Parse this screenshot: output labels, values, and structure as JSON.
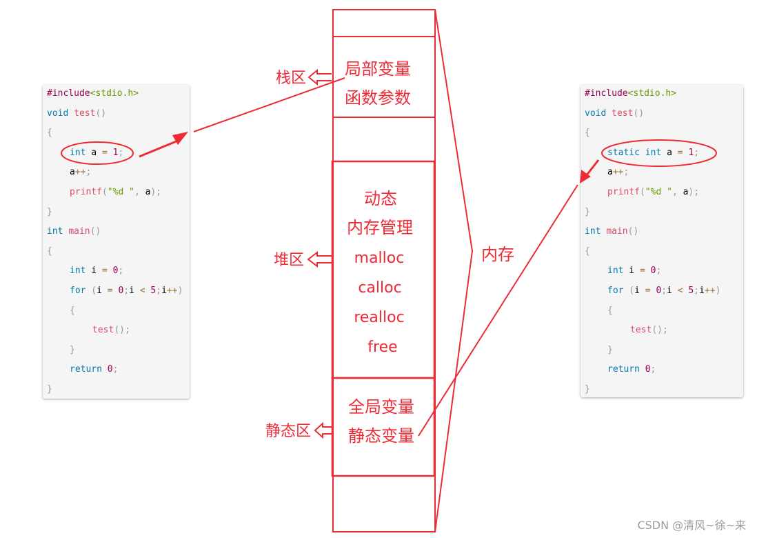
{
  "colors": {
    "accent": "#ee2a35",
    "code_bg": "#f5f5f5",
    "keyword": "#0077aa",
    "function": "#dd4a68",
    "string": "#669900",
    "number": "#990055"
  },
  "left_code": {
    "lines": [
      {
        "indent": 0,
        "tokens": [
          {
            "t": "#include",
            "c": "inc"
          },
          {
            "t": "<stdio.h>",
            "c": "hdr"
          }
        ]
      },
      {
        "indent": 0,
        "tokens": [
          {
            "t": "void",
            "c": "k"
          },
          {
            "t": " ",
            "c": "v"
          },
          {
            "t": "test",
            "c": "fn"
          },
          {
            "t": "()",
            "c": "p"
          }
        ]
      },
      {
        "indent": 0,
        "tokens": [
          {
            "t": "{",
            "c": "p"
          }
        ]
      },
      {
        "indent": 1,
        "tokens": [
          {
            "t": "int",
            "c": "k"
          },
          {
            "t": " a ",
            "c": "v"
          },
          {
            "t": "=",
            "c": "op"
          },
          {
            "t": " ",
            "c": "v"
          },
          {
            "t": "1",
            "c": "num"
          },
          {
            "t": ";",
            "c": "p"
          }
        ]
      },
      {
        "indent": 1,
        "tokens": [
          {
            "t": "a",
            "c": "v"
          },
          {
            "t": "++",
            "c": "op"
          },
          {
            "t": ";",
            "c": "p"
          }
        ]
      },
      {
        "indent": 1,
        "tokens": [
          {
            "t": "printf",
            "c": "fn"
          },
          {
            "t": "(",
            "c": "p"
          },
          {
            "t": "\"%d \"",
            "c": "str"
          },
          {
            "t": ", ",
            "c": "p"
          },
          {
            "t": "a",
            "c": "v"
          },
          {
            "t": ");",
            "c": "p"
          }
        ]
      },
      {
        "indent": 0,
        "tokens": [
          {
            "t": "}",
            "c": "p"
          }
        ]
      },
      {
        "indent": 0,
        "tokens": [
          {
            "t": "int",
            "c": "k"
          },
          {
            "t": " ",
            "c": "v"
          },
          {
            "t": "main",
            "c": "fn"
          },
          {
            "t": "()",
            "c": "p"
          }
        ]
      },
      {
        "indent": 0,
        "tokens": [
          {
            "t": "{",
            "c": "p"
          }
        ]
      },
      {
        "indent": 1,
        "tokens": [
          {
            "t": "int",
            "c": "k"
          },
          {
            "t": " i ",
            "c": "v"
          },
          {
            "t": "=",
            "c": "op"
          },
          {
            "t": " ",
            "c": "v"
          },
          {
            "t": "0",
            "c": "num"
          },
          {
            "t": ";",
            "c": "p"
          }
        ]
      },
      {
        "indent": 1,
        "tokens": [
          {
            "t": "for",
            "c": "k"
          },
          {
            "t": " (",
            "c": "p"
          },
          {
            "t": "i ",
            "c": "v"
          },
          {
            "t": "=",
            "c": "op"
          },
          {
            "t": " ",
            "c": "v"
          },
          {
            "t": "0",
            "c": "num"
          },
          {
            "t": ";",
            "c": "p"
          },
          {
            "t": "i ",
            "c": "v"
          },
          {
            "t": "<",
            "c": "op"
          },
          {
            "t": " ",
            "c": "v"
          },
          {
            "t": "5",
            "c": "num"
          },
          {
            "t": ";",
            "c": "p"
          },
          {
            "t": "i",
            "c": "v"
          },
          {
            "t": "++",
            "c": "op"
          },
          {
            "t": ")",
            "c": "p"
          }
        ]
      },
      {
        "indent": 1,
        "tokens": [
          {
            "t": "{",
            "c": "p"
          }
        ]
      },
      {
        "indent": 2,
        "tokens": [
          {
            "t": "test",
            "c": "fn"
          },
          {
            "t": "();",
            "c": "p"
          }
        ]
      },
      {
        "indent": 1,
        "tokens": [
          {
            "t": "}",
            "c": "p"
          }
        ]
      },
      {
        "indent": 1,
        "tokens": [
          {
            "t": "return",
            "c": "k"
          },
          {
            "t": " ",
            "c": "v"
          },
          {
            "t": "0",
            "c": "num"
          },
          {
            "t": ";",
            "c": "p"
          }
        ]
      },
      {
        "indent": 0,
        "tokens": [
          {
            "t": "}",
            "c": "p"
          }
        ]
      }
    ],
    "highlighted_line": "int a = 1;"
  },
  "right_code": {
    "lines": [
      {
        "indent": 0,
        "tokens": [
          {
            "t": "#include",
            "c": "inc"
          },
          {
            "t": "<stdio.h>",
            "c": "hdr"
          }
        ]
      },
      {
        "indent": 0,
        "tokens": [
          {
            "t": "void",
            "c": "k"
          },
          {
            "t": " ",
            "c": "v"
          },
          {
            "t": "test",
            "c": "fn"
          },
          {
            "t": "()",
            "c": "p"
          }
        ]
      },
      {
        "indent": 0,
        "tokens": [
          {
            "t": "{",
            "c": "p"
          }
        ]
      },
      {
        "indent": 1,
        "tokens": [
          {
            "t": "static",
            "c": "k"
          },
          {
            "t": " ",
            "c": "v"
          },
          {
            "t": "int",
            "c": "k"
          },
          {
            "t": " a ",
            "c": "v"
          },
          {
            "t": "=",
            "c": "op"
          },
          {
            "t": " ",
            "c": "v"
          },
          {
            "t": "1",
            "c": "num"
          },
          {
            "t": ";",
            "c": "p"
          }
        ]
      },
      {
        "indent": 1,
        "tokens": [
          {
            "t": "a",
            "c": "v"
          },
          {
            "t": "++",
            "c": "op"
          },
          {
            "t": ";",
            "c": "p"
          }
        ]
      },
      {
        "indent": 1,
        "tokens": [
          {
            "t": "printf",
            "c": "fn"
          },
          {
            "t": "(",
            "c": "p"
          },
          {
            "t": "\"%d \"",
            "c": "str"
          },
          {
            "t": ", ",
            "c": "p"
          },
          {
            "t": "a",
            "c": "v"
          },
          {
            "t": ");",
            "c": "p"
          }
        ]
      },
      {
        "indent": 0,
        "tokens": [
          {
            "t": "}",
            "c": "p"
          }
        ]
      },
      {
        "indent": 0,
        "tokens": [
          {
            "t": "int",
            "c": "k"
          },
          {
            "t": " ",
            "c": "v"
          },
          {
            "t": "main",
            "c": "fn"
          },
          {
            "t": "()",
            "c": "p"
          }
        ]
      },
      {
        "indent": 0,
        "tokens": [
          {
            "t": "{",
            "c": "p"
          }
        ]
      },
      {
        "indent": 1,
        "tokens": [
          {
            "t": "int",
            "c": "k"
          },
          {
            "t": " i ",
            "c": "v"
          },
          {
            "t": "=",
            "c": "op"
          },
          {
            "t": " ",
            "c": "v"
          },
          {
            "t": "0",
            "c": "num"
          },
          {
            "t": ";",
            "c": "p"
          }
        ]
      },
      {
        "indent": 1,
        "tokens": [
          {
            "t": "for",
            "c": "k"
          },
          {
            "t": " (",
            "c": "p"
          },
          {
            "t": "i ",
            "c": "v"
          },
          {
            "t": "=",
            "c": "op"
          },
          {
            "t": " ",
            "c": "v"
          },
          {
            "t": "0",
            "c": "num"
          },
          {
            "t": ";",
            "c": "p"
          },
          {
            "t": "i ",
            "c": "v"
          },
          {
            "t": "<",
            "c": "op"
          },
          {
            "t": " ",
            "c": "v"
          },
          {
            "t": "5",
            "c": "num"
          },
          {
            "t": ";",
            "c": "p"
          },
          {
            "t": "i",
            "c": "v"
          },
          {
            "t": "++",
            "c": "op"
          },
          {
            "t": ")",
            "c": "p"
          }
        ]
      },
      {
        "indent": 1,
        "tokens": [
          {
            "t": "{",
            "c": "p"
          }
        ]
      },
      {
        "indent": 2,
        "tokens": [
          {
            "t": "test",
            "c": "fn"
          },
          {
            "t": "();",
            "c": "p"
          }
        ]
      },
      {
        "indent": 1,
        "tokens": [
          {
            "t": "}",
            "c": "p"
          }
        ]
      },
      {
        "indent": 1,
        "tokens": [
          {
            "t": "return",
            "c": "k"
          },
          {
            "t": " ",
            "c": "v"
          },
          {
            "t": "0",
            "c": "num"
          },
          {
            "t": ";",
            "c": "p"
          }
        ]
      },
      {
        "indent": 0,
        "tokens": [
          {
            "t": "}",
            "c": "p"
          }
        ]
      }
    ],
    "highlighted_line": "static int a = 1;"
  },
  "memory": {
    "brace_label": "内存",
    "stack": {
      "label": "栈区",
      "lines": [
        "局部变量",
        "函数参数"
      ]
    },
    "heap": {
      "label": "堆区",
      "lines": [
        "动态",
        "内存管理",
        "malloc",
        "calloc",
        "realloc",
        "free"
      ]
    },
    "static": {
      "label": "静态区",
      "lines": [
        "全局变量",
        "静态变量"
      ]
    }
  },
  "watermark": "CSDN @清风~徐~来"
}
